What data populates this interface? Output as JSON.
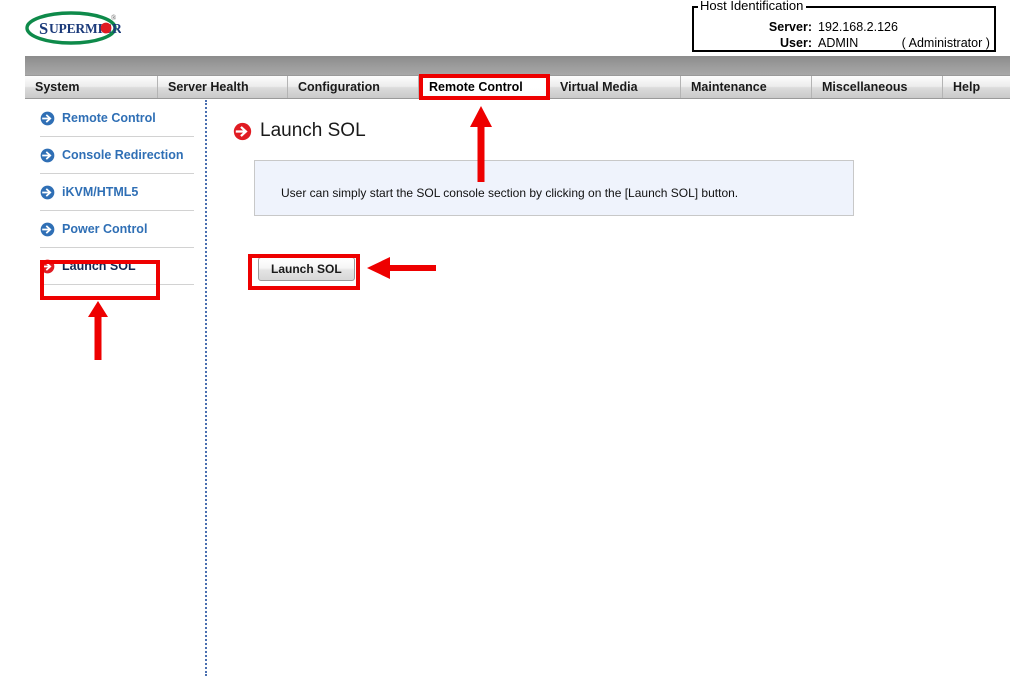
{
  "header": {
    "logo_alt": "SUPERMICRO",
    "logo_text": "SUPERMICR",
    "host_identification": {
      "legend": "Host Identification",
      "server_label": "Server:",
      "server_value": "192.168.2.126",
      "user_label": "User:",
      "user_value": "ADMIN",
      "user_role": "( Administrator )"
    }
  },
  "menu": {
    "items": [
      {
        "label": "System",
        "active": false
      },
      {
        "label": "Server Health",
        "active": false
      },
      {
        "label": "Configuration",
        "active": false
      },
      {
        "label": "Remote Control",
        "active": true
      },
      {
        "label": "Virtual Media",
        "active": false
      },
      {
        "label": "Maintenance",
        "active": false
      },
      {
        "label": "Miscellaneous",
        "active": false
      },
      {
        "label": "Help",
        "active": false
      }
    ]
  },
  "sidebar": {
    "items": [
      {
        "label": "Remote Control",
        "icon": "circle-arrow-icon",
        "selected": false
      },
      {
        "label": "Console Redirection",
        "icon": "circle-arrow-icon",
        "selected": false
      },
      {
        "label": "iKVM/HTML5",
        "icon": "circle-arrow-icon",
        "selected": false
      },
      {
        "label": "Power Control",
        "icon": "circle-arrow-icon",
        "selected": false
      },
      {
        "label": "Launch SOL",
        "icon": "circle-arrow-icon",
        "selected": true
      }
    ]
  },
  "main": {
    "title": "Launch SOL",
    "title_icon": "circle-arrow-icon",
    "info_text": "User can simply start the SOL console section by clicking on the [Launch SOL] button.",
    "launch_button_label": "Launch SOL"
  },
  "annotations": {
    "color": "#ee0000",
    "boxes": [
      {
        "name": "remote-control-tab-highlight"
      },
      {
        "name": "launch-sol-sidebar-highlight"
      },
      {
        "name": "launch-sol-button-highlight"
      }
    ],
    "arrows": [
      {
        "name": "arrow-up-to-remote-control-tab",
        "direction": "up"
      },
      {
        "name": "arrow-up-to-launch-sol-sidebar",
        "direction": "up"
      },
      {
        "name": "arrow-left-to-launch-sol-button",
        "direction": "left"
      }
    ]
  },
  "colors": {
    "accent_blue": "#2f6fb5",
    "selected_navy": "#12264f",
    "annotation_red": "#ee0000",
    "logo_green": "#0e8a4a",
    "logo_blue": "#1b3a7a",
    "logo_red": "#e01b22",
    "info_panel_bg": "#eff3fc"
  }
}
